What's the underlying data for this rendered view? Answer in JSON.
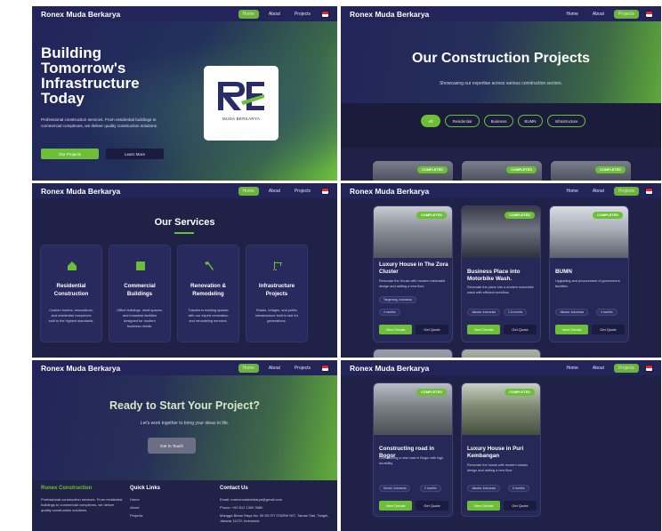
{
  "brand": "Ronex Muda Berkarya",
  "nav": {
    "home": "Home",
    "about": "About",
    "projects": "Projects"
  },
  "hero": {
    "title": "Building Tomorrow's Infrastructure Today",
    "description": "Professional construction services. From residential buildings to commercial complexes, we deliver quality construction solutions.",
    "primary_button": "Our Projects",
    "secondary_button": "Learn More",
    "logo_caption": "MUDA BERKARYA"
  },
  "projects_page": {
    "title": "Our Construction Projects",
    "subtitle": "Showcasing our expertise across various construction sectors.",
    "filters": [
      "All",
      "Residential",
      "Business",
      "BUMN",
      "Infrastructure"
    ],
    "badge": "COMPLETED"
  },
  "services": {
    "title": "Our Services",
    "items": [
      {
        "name": "Residential Construction",
        "desc": "Custom homes, renovations, and residential complexes built to the highest standards."
      },
      {
        "name": "Commercial Buildings",
        "desc": "Office buildings, retail spaces, and industrial facilities designed for modern business needs."
      },
      {
        "name": "Renovation & Remodeling",
        "desc": "Transform existing spaces with our expert renovation and remodeling services."
      },
      {
        "name": "Infrastructure Projects",
        "desc": "Roads, bridges, and public infrastructure built to last for generations."
      }
    ]
  },
  "project_cards": {
    "view_label": "View Details",
    "quote_label": "Get Quote",
    "badge": "COMPLETED",
    "row1": [
      {
        "title": "Luxury House in The Zora Cluster",
        "desc": "Renovate the House with modern minimalist design and adding a new floor.",
        "tags": [
          "Tangerang, Indonesia",
          "4 months"
        ]
      },
      {
        "title": "Business Place into Motorbike Wash.",
        "desc": "Renovate the place into a modern motorbike wash with efficient workflow.",
        "tags": [
          "Jakarta, Indonesia",
          "1.5 months"
        ]
      },
      {
        "title": "BUMN",
        "desc": "Upgrading and procurement of government facilities.",
        "tags": [
          "Jakarta, Indonesia",
          "4 months"
        ]
      }
    ],
    "row2": [
      {
        "title": "Constructing road in Bogor",
        "desc": "Constructing a new road in Bogor with high durability.",
        "tags": [
          "Sentul, Indonesia",
          "2 months"
        ]
      },
      {
        "title": "Luxury House in Puri Kembangan",
        "desc": "Renovate the house with modern classic design and adding a new floor.",
        "tags": [
          "Jakarta, Indonesia",
          "6 months"
        ]
      }
    ]
  },
  "cta": {
    "title": "Ready to Start Your Project?",
    "subtitle": "Let's work together to bring your ideas to life.",
    "button": "Get In Touch"
  },
  "footer": {
    "brand": "Ronex Construction",
    "about": "Professional construction services. From residential buildings to commercial complexes, we deliver quality construction solutions.",
    "links_title": "Quick Links",
    "links": [
      "Home",
      "About",
      "Projects"
    ],
    "contact_title": "Contact Us",
    "email": "Email: ronexmudaberkarya@gmail.com",
    "phone": "Phone: +62 812 1300 3080",
    "address": "Mangga Besar Raya No. 59 DE RT 07&RW 007, Taman Sari, Tangki, Jakarta 11170, Indonesia"
  },
  "colors": {
    "accent": "#6cbf37",
    "navy": "#1f2146",
    "nav": "#23245a"
  }
}
